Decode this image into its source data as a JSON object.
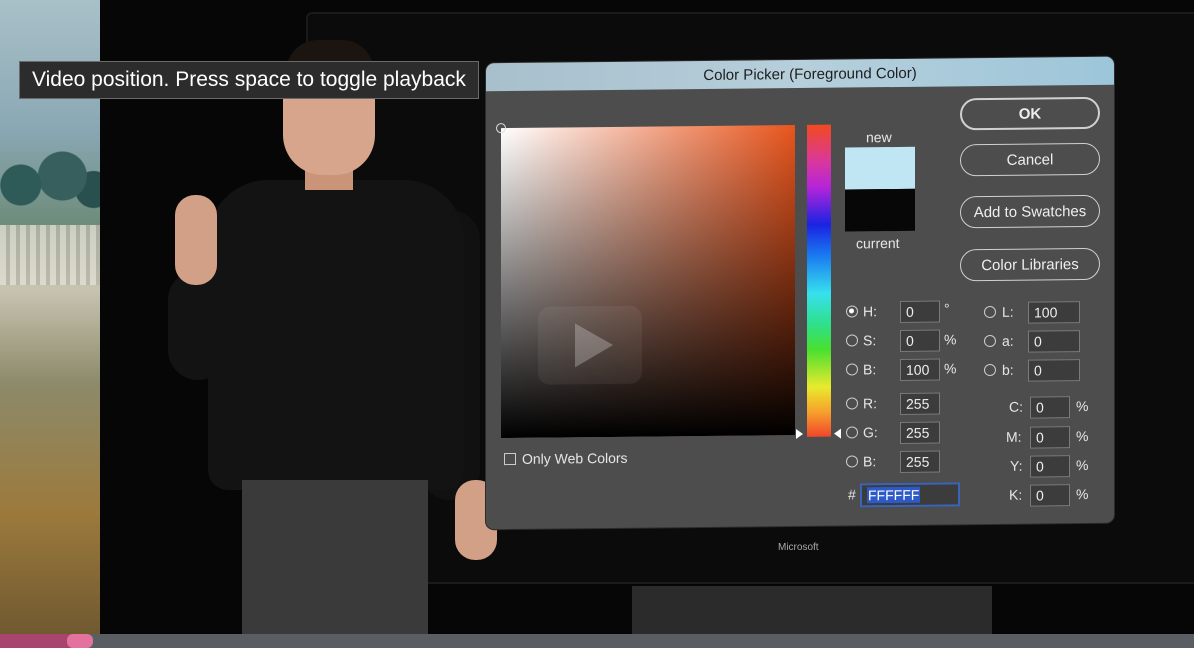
{
  "tooltip": {
    "text": "Video position. Press space to toggle playback"
  },
  "monitor": {
    "brand": "Microsoft"
  },
  "dialog": {
    "title": "Color Picker (Foreground Color)",
    "new_label": "new",
    "current_label": "current",
    "new_color": "#bfe6f2",
    "current_color": "#070707",
    "buttons": {
      "ok": "OK",
      "cancel": "Cancel",
      "add_to_swatches": "Add to Swatches",
      "color_libraries": "Color Libraries"
    },
    "only_web_colors": "Only Web Colors",
    "hsb": {
      "h": {
        "label": "H:",
        "value": "0",
        "unit": "°"
      },
      "s": {
        "label": "S:",
        "value": "0",
        "unit": "%"
      },
      "b": {
        "label": "B:",
        "value": "100",
        "unit": "%"
      }
    },
    "rgb": {
      "r": {
        "label": "R:",
        "value": "255"
      },
      "g": {
        "label": "G:",
        "value": "255"
      },
      "b": {
        "label": "B:",
        "value": "255"
      }
    },
    "lab": {
      "l": {
        "label": "L:",
        "value": "100"
      },
      "a": {
        "label": "a:",
        "value": "0"
      },
      "b": {
        "label": "b:",
        "value": "0"
      }
    },
    "cmyk": {
      "c": {
        "label": "C:",
        "value": "0",
        "unit": "%"
      },
      "m": {
        "label": "M:",
        "value": "0",
        "unit": "%"
      },
      "y": {
        "label": "Y:",
        "value": "0",
        "unit": "%"
      },
      "k": {
        "label": "K:",
        "value": "0",
        "unit": "%"
      }
    },
    "hex": {
      "label": "#",
      "value": "FFFFFF"
    }
  },
  "player": {
    "progress_fraction": 0.067,
    "accent_color": "#a8446e"
  }
}
